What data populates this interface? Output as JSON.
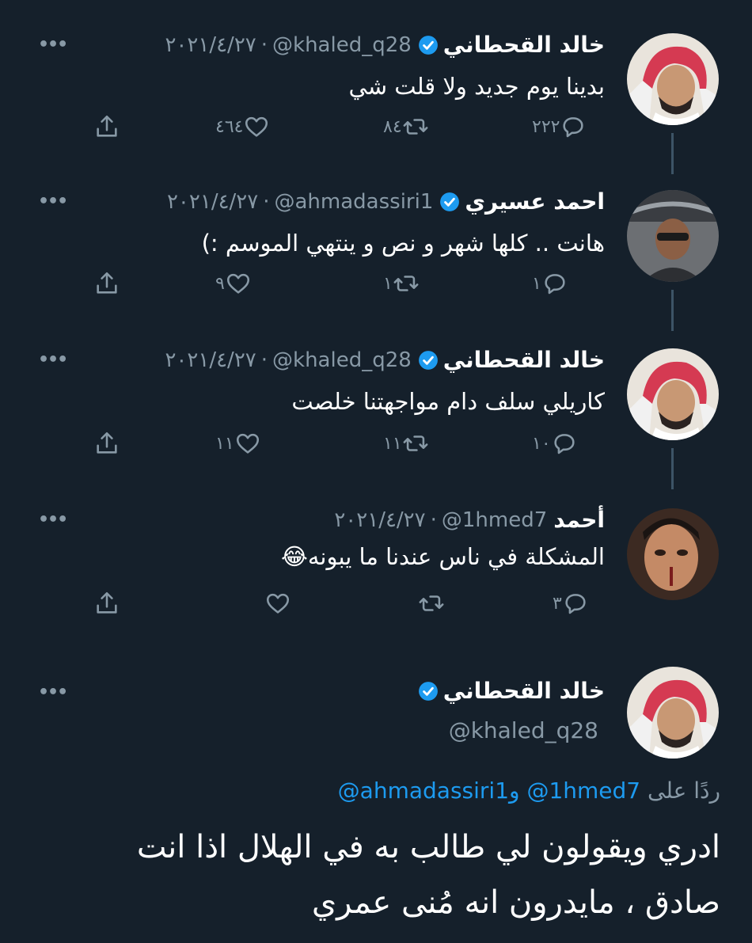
{
  "tweets": [
    {
      "name": "خالد القحطاني",
      "handle": "@khaled_q28",
      "date": "٢٠٢١/٤/٢٧",
      "text": "بدينا يوم جديد ولا قلت شي",
      "replies": "٢٢٢",
      "retweets": "٨٤",
      "likes": "٤٦٤",
      "avatar": "khaled-avatar",
      "verified": true
    },
    {
      "name": "احمد عسيري",
      "handle": "@ahmadassiri1",
      "date": "٢٠٢١/٤/٢٧",
      "text": "هانت .. كلها شهر و نص و ينتهي الموسم :)",
      "replies": "١",
      "retweets": "١",
      "likes": "٩",
      "avatar": "ahmad-avatar",
      "verified": true
    },
    {
      "name": "خالد القحطاني",
      "handle": "@khaled_q28",
      "date": "٢٠٢١/٤/٢٧",
      "text": "كاريلي سلف دام مواجهتنا خلصت",
      "replies": "١٠",
      "retweets": "١١",
      "likes": "١١",
      "avatar": "khaled-avatar",
      "verified": true
    },
    {
      "name": "أحمد",
      "handle": "@1hmed7",
      "date": "٢٠٢١/٤/٢٧",
      "text": "المشكلة في ناس عندنا ما يبونه😂",
      "replies": "٣",
      "retweets": "",
      "likes": "",
      "avatar": "hmed-avatar",
      "verified": false
    }
  ],
  "main_tweet": {
    "name": "خالد القحطاني",
    "handle": "@khaled_q28",
    "reply_prefix": "ردًا على",
    "reply_mention_1": "@1hmed7",
    "reply_joiner": "و",
    "reply_mention_2": "@ahmadassiri1",
    "text_line_1": "ادري ويقولون لي طالب به في الهلال اذا انت",
    "text_line_2": "صادق ، مايدرون انه مُنى عمري"
  },
  "ui": {
    "date_separator": "·",
    "more_icon": "more-icon",
    "more_label": "•••"
  },
  "colors": {
    "background": "#15202b",
    "secondary_text": "#8899a6",
    "verified": "#1d9bf0",
    "link": "#1d9bf0"
  }
}
